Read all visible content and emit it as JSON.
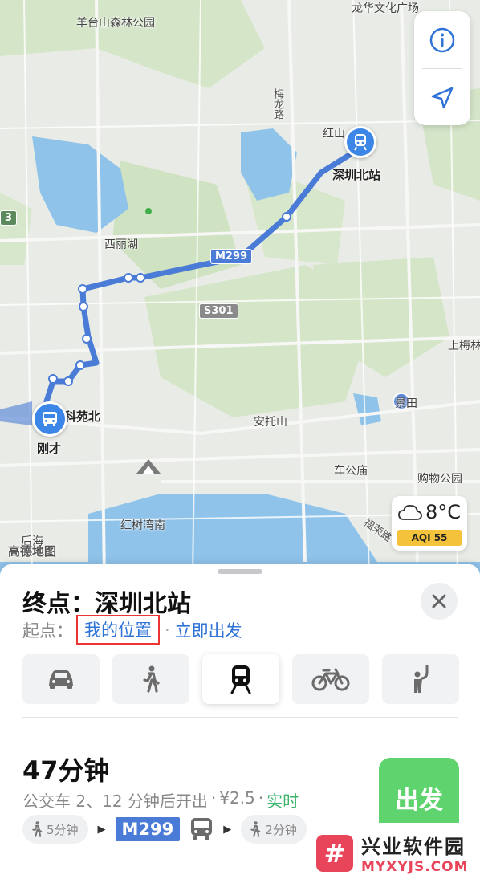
{
  "map": {
    "labels": {
      "yangtaishan": "羊台山森林公园",
      "longhua_culture": "龙华文化广场",
      "meilong_road": "梅龙路",
      "hongshan": "红山",
      "xilihu": "西丽湖",
      "kexinbei": "科苑北",
      "gangcai": "刚才",
      "antuoshan": "安托山",
      "jingtian": "景田",
      "shangmei": "上梅林",
      "chegongmiao": "车公庙",
      "gouwu_park": "购物公园",
      "hongshuwan": "红树湾南",
      "houhai": "后海",
      "futian": "福荣路",
      "dest_station": "深圳北站"
    },
    "road_badges": {
      "m299": "M299",
      "s301": "S301",
      "edge_left": "3"
    },
    "logo": "高德地图",
    "controls": {
      "info_icon": "info-icon",
      "locate_icon": "location-arrow-icon"
    },
    "weather": {
      "temp": "8°C",
      "aqi": "AQI 55",
      "icon": "cloud-icon"
    }
  },
  "sheet": {
    "title": "终点：深圳北站",
    "origin_label": "起点：",
    "origin_value": "我的位置",
    "separator": "·",
    "depart_value": "立即出发",
    "modes": [
      {
        "name": "car",
        "icon": "car-icon"
      },
      {
        "name": "walk",
        "icon": "walk-icon"
      },
      {
        "name": "transit",
        "icon": "train-icon",
        "active": true
      },
      {
        "name": "bike",
        "icon": "bike-icon"
      },
      {
        "name": "ride",
        "icon": "hail-icon"
      }
    ],
    "route": {
      "duration": "47分钟",
      "desc": "公交车 2、12 分钟后开出",
      "sep1": "·",
      "fare": "¥2.5",
      "sep2": "·",
      "status": "实时",
      "go_label": "出发",
      "steps": {
        "walk1": "5分钟",
        "arrow": "▶",
        "bus": "M299",
        "walk2": "2分钟"
      }
    }
  },
  "watermark": {
    "logo_char": "#",
    "title": "兴业软件园",
    "url": "MYXYJS.COM"
  },
  "colors": {
    "accent": "#2f73d8",
    "route": "#4a7bd6",
    "go": "#5fd36d",
    "realtime": "#3cb36b",
    "highlight": "#e33333"
  }
}
